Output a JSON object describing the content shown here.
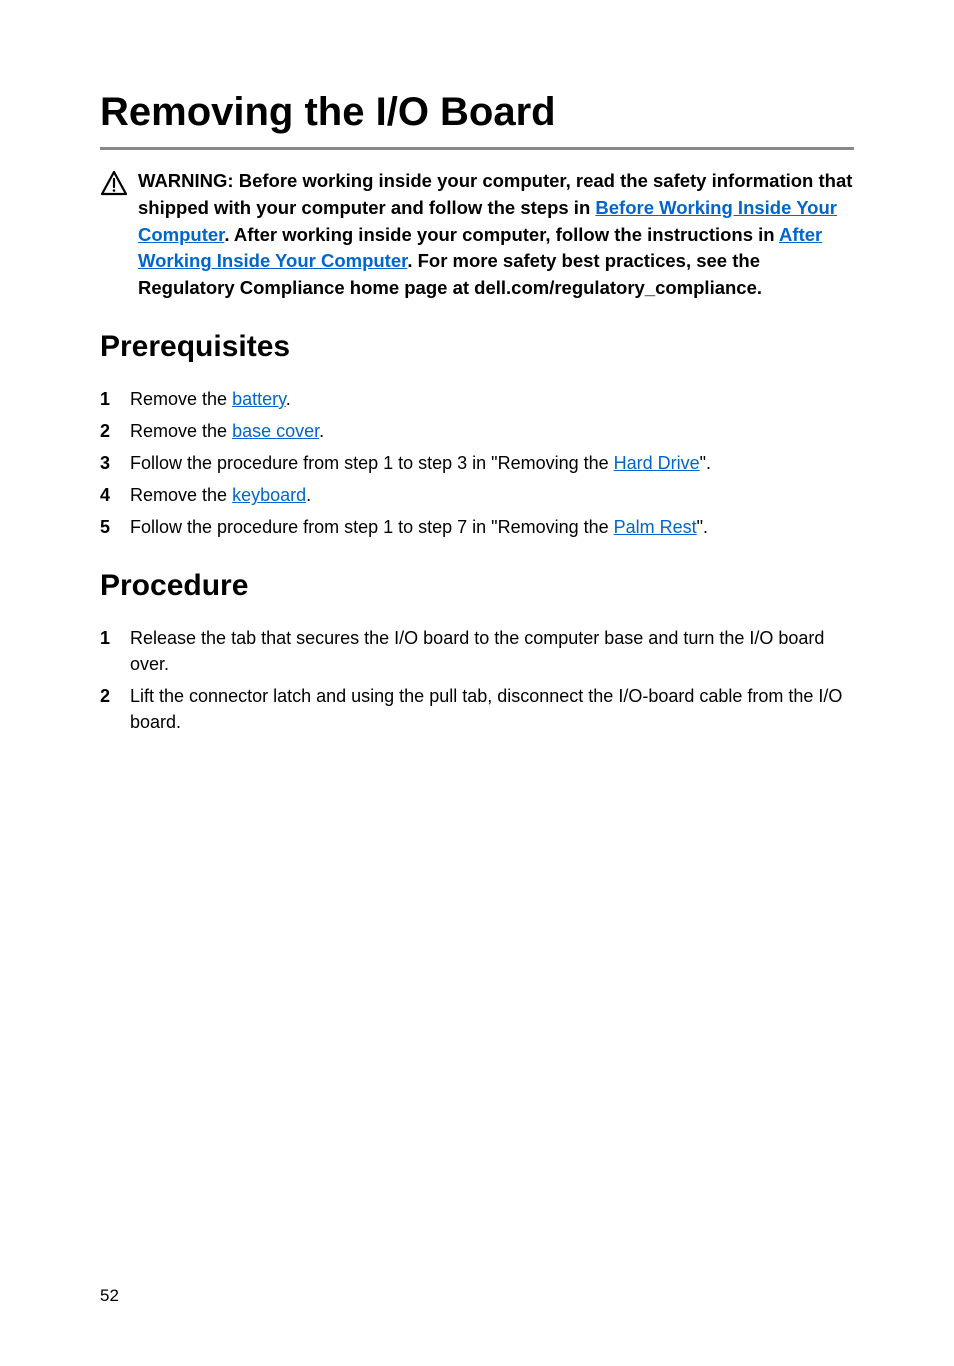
{
  "title": "Removing the I/O Board",
  "warning": {
    "prefix": "WARNING: Before working inside your computer, read the safety information that shipped with your computer and follow the steps in ",
    "link1": "Before Working Inside Your Computer",
    "mid1": ". After working inside your computer, follow the instructions in ",
    "link2": "After Working Inside Your Computer",
    "suffix": ". For more safety best practices, see the Regulatory Compliance home page at dell.com/regulatory_compliance."
  },
  "sections": {
    "prerequisites": {
      "heading": "Prerequisites",
      "items": [
        {
          "pre": "Remove the ",
          "link": "battery",
          "post": "."
        },
        {
          "pre": "Remove the ",
          "link": "base cover",
          "post": "."
        },
        {
          "pre": "Follow the procedure from step 1 to step 3 in \"Removing the ",
          "link": "Hard Drive",
          "post": "\"."
        },
        {
          "pre": "Remove the ",
          "link": "keyboard",
          "post": "."
        },
        {
          "pre": "Follow the procedure from step 1 to step 7 in \"Removing the ",
          "link": "Palm Rest",
          "post": "\"."
        }
      ]
    },
    "procedure": {
      "heading": "Procedure",
      "items": [
        {
          "text": "Release the tab that secures the I/O board to the computer base and turn the I/O board over."
        },
        {
          "text": "Lift the connector latch and using the pull tab, disconnect the I/O-board cable from the I/O board."
        }
      ]
    }
  },
  "pageNumber": "52"
}
